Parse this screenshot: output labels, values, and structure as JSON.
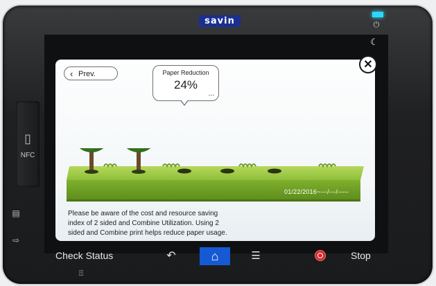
{
  "device": {
    "brand": "savin",
    "nfc_label": "NFC"
  },
  "screen": {
    "prev_label": "Prev.",
    "bubble": {
      "title": "Paper Reduction",
      "value": "24%",
      "more": "..."
    },
    "date_range": "01/22/2016~---/---/-----",
    "message": "Please be aware of the cost and resource saving index of 2 sided and Combine Utilization. Using 2 sided and Combine print helps reduce paper usage.",
    "trees_shown": 2,
    "tree_slots": 5
  },
  "taskbar": {
    "check_status": "Check Status",
    "stop": "Stop",
    "home_active": true
  },
  "icons": {
    "back": "back-arrow-icon",
    "home": "home-icon",
    "menu": "menu-icon",
    "stop": "stop-icon",
    "close": "close-icon",
    "moon": "energy-saver-moon-icon",
    "power": "power-icon",
    "nfc": "nfc-phone-icon"
  },
  "colors": {
    "brand_bg": "#1a2f8f",
    "home_active": "#1559d4",
    "stop_red": "#d42a2a",
    "grass": "#8fbf3a",
    "led": "#2ad8ff"
  }
}
